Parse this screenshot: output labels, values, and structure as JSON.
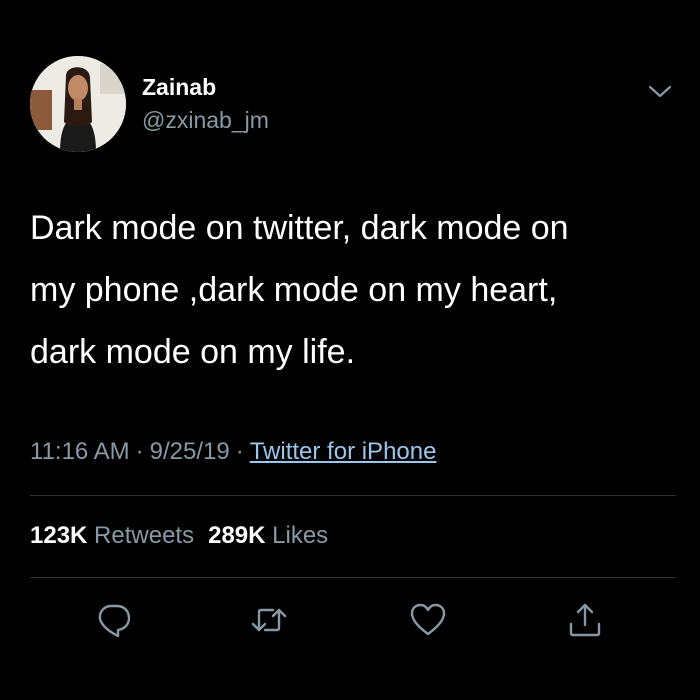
{
  "user": {
    "display_name": "Zainab",
    "handle": "@zxinab_jm"
  },
  "tweet": {
    "text": "Dark mode on twitter, dark mode on\nmy phone ,dark mode on my heart,\ndark mode on my life."
  },
  "meta": {
    "time": "11:16 AM",
    "separator": "·",
    "date": "9/25/19",
    "source": "Twitter for iPhone"
  },
  "stats": {
    "retweets_count": "123K",
    "retweets_label": "Retweets",
    "likes_count": "289K",
    "likes_label": "Likes"
  },
  "icons": {
    "more": "chevron-down-icon",
    "reply": "reply-icon",
    "retweet": "retweet-icon",
    "like": "heart-icon",
    "share": "share-icon"
  },
  "colors": {
    "background": "#000000",
    "text_primary": "#ffffff",
    "text_secondary": "#8899a6",
    "link": "#9bc7ec",
    "divider": "#2f3336"
  }
}
